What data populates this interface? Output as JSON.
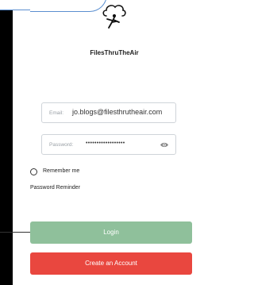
{
  "app": {
    "name": "FilesThruTheAir",
    "logo_icon": "cloud-flyer-logo-icon"
  },
  "login_form": {
    "email_label": "Email:",
    "email_value": "jo.blogs@filesthrutheair.com",
    "password_label": "Password:",
    "password_value": "••••••••••••••••••",
    "show_password_icon": "eye-icon",
    "remember_me_label": "Remember me",
    "remember_me_checked": false,
    "password_reminder_label": "Password Reminder"
  },
  "buttons": {
    "login_label": "Login",
    "create_account_label": "Create an Account"
  },
  "colors": {
    "login_button": "#8fc09b",
    "create_account_button": "#e9473f",
    "callout_border": "#5b8fd0"
  }
}
